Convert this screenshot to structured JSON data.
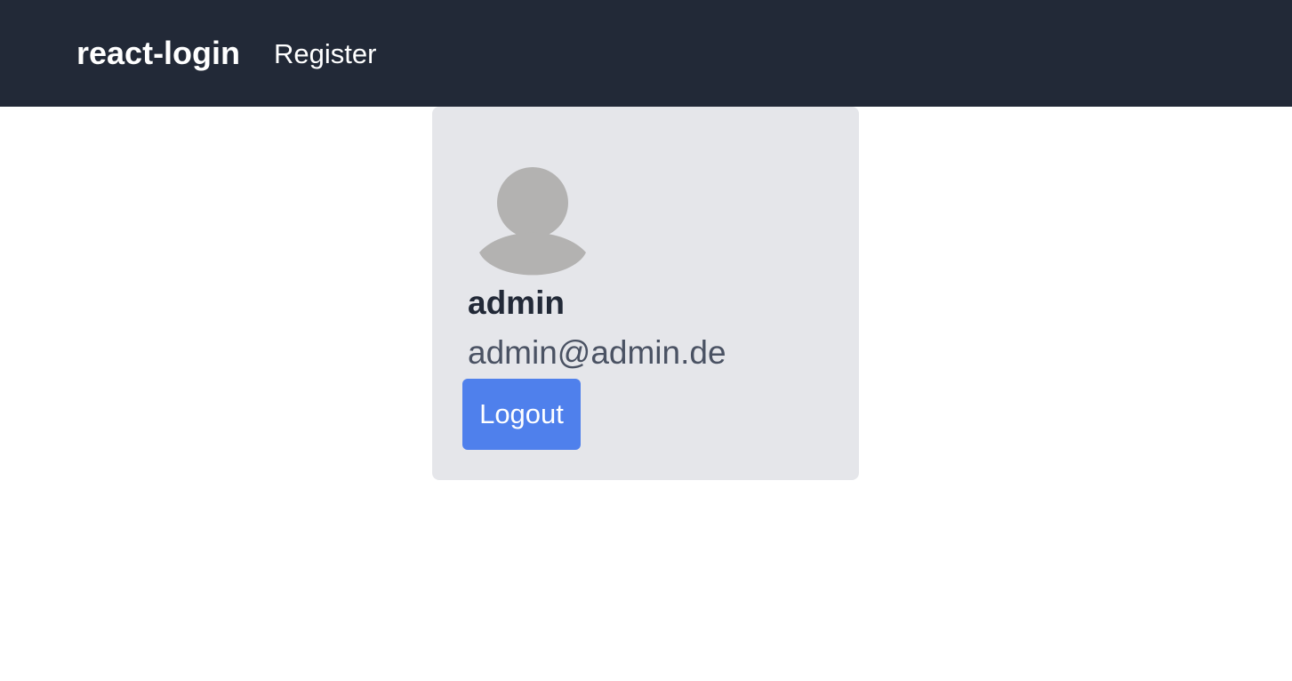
{
  "navbar": {
    "brand": "react-login",
    "links": [
      {
        "label": "Register"
      }
    ]
  },
  "profile": {
    "avatar_icon": "user-avatar-icon",
    "username": "admin",
    "email": "admin@admin.de",
    "logout_label": "Logout"
  },
  "colors": {
    "navbar_bg": "#222937",
    "card_bg": "#e5e6ea",
    "button_bg": "#4f80ec",
    "avatar_fill": "#b3b2b1"
  }
}
